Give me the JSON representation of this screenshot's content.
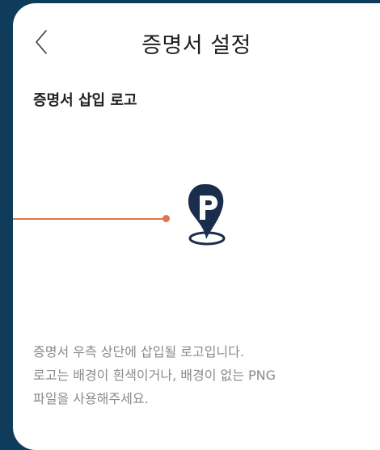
{
  "header": {
    "title": "증명서 설정",
    "back_icon": "chevron-left-icon"
  },
  "section": {
    "title": "증명서 삽입 로고"
  },
  "logo": {
    "icon": "location-pin-p-icon",
    "colors": {
      "pin": "#1b2d4d",
      "accent_line": "#e4724a"
    }
  },
  "description": {
    "lines": [
      "증명서 우측 상단에 삽입될 로고입니다.",
      "로고는 배경이 흰색이거나, 배경이 없는 PNG",
      "파일을 사용해주세요."
    ]
  },
  "colors": {
    "background": "#0e3c5a",
    "card": "#ffffff",
    "text_primary": "#1d1d1d",
    "text_secondary": "#8a8a8a"
  }
}
